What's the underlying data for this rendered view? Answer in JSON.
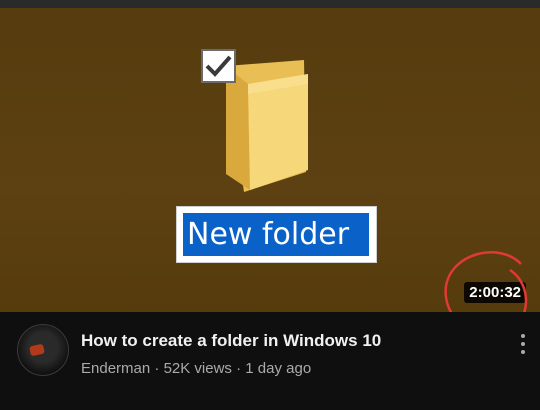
{
  "thumbnail": {
    "rename_text": "New folder",
    "duration": "2:00:32",
    "colors": {
      "background": "#5b3f10",
      "folder": "#f3cf6a",
      "selection": "#0a62c9",
      "annotation": "#e03a32"
    },
    "icons": [
      "checkbox-icon",
      "folder-icon"
    ]
  },
  "video": {
    "title": "How to create a folder in Windows 10",
    "channel": "Enderman",
    "separator": "·",
    "views": "52K views",
    "age": "1 day ago"
  },
  "menu_icon": "more-vert-icon"
}
